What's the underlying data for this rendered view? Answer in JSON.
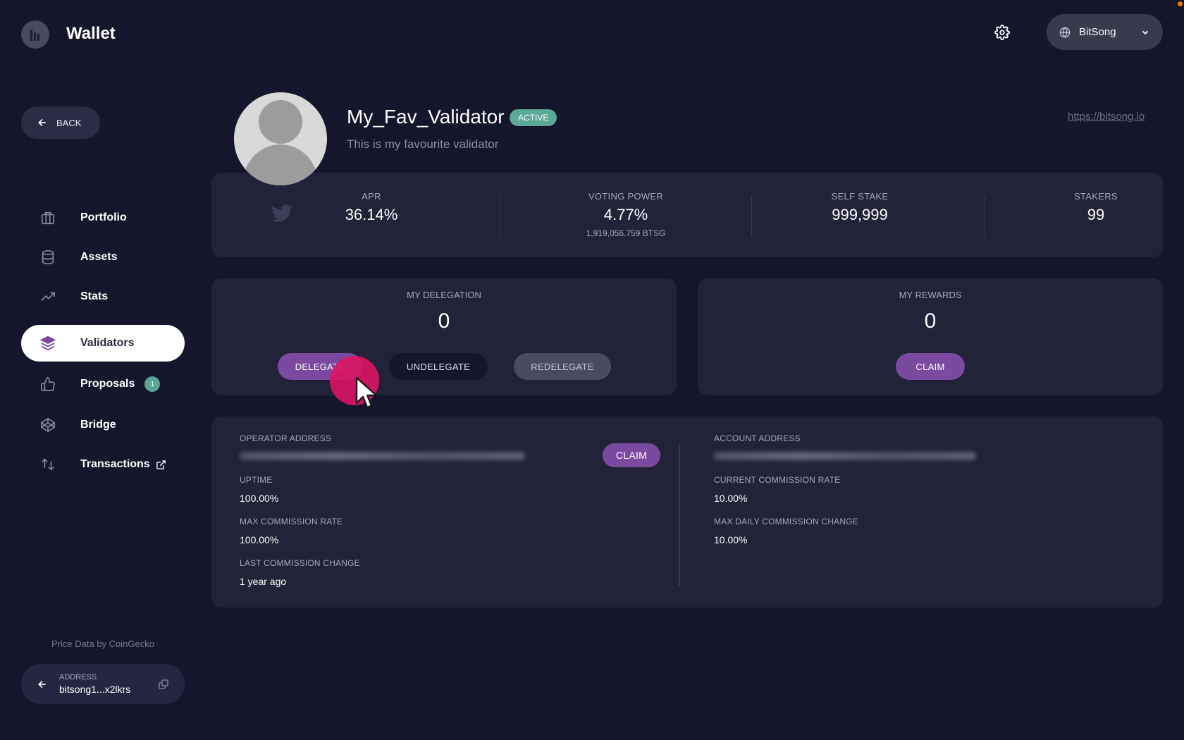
{
  "header": {
    "app_title": "Wallet",
    "network": "BitSong"
  },
  "sidebar": {
    "back_label": "BACK",
    "items": [
      {
        "label": "Portfolio",
        "icon": "briefcase-icon"
      },
      {
        "label": "Assets",
        "icon": "database-icon"
      },
      {
        "label": "Stats",
        "icon": "trending-up-icon"
      },
      {
        "label": "Validators",
        "icon": "layers-icon",
        "active": true
      },
      {
        "label": "Proposals",
        "icon": "thumbs-up-icon",
        "badge": "1"
      },
      {
        "label": "Bridge",
        "icon": "bridge-icon"
      },
      {
        "label": "Transactions",
        "icon": "swap-icon",
        "external": true
      }
    ],
    "price_data": "Price Data by CoinGecko",
    "address_label": "ADDRESS",
    "address_value": "bitsong1...x2lkrs"
  },
  "validator": {
    "name": "My_Fav_Validator",
    "status": "ACTIVE",
    "description": "This is my favourite validator",
    "website": "https://bitsong.io"
  },
  "stats": {
    "apr_label": "APR",
    "apr": "36.14%",
    "voting_power_label": "VOTING POWER",
    "voting_power": "4.77%",
    "voting_power_sub": "1,919,056.759 BTSG",
    "self_stake_label": "SELF STAKE",
    "self_stake": "999,999",
    "stakers_label": "STAKERS",
    "stakers": "99"
  },
  "delegation": {
    "title": "MY DELEGATION",
    "value": "0",
    "delegate": "DELEGATE",
    "undelegate": "UNDELEGATE",
    "redelegate": "REDELEGATE"
  },
  "rewards": {
    "title": "MY REWARDS",
    "value": "0",
    "claim": "CLAIM"
  },
  "details": {
    "operator_address_label": "OPERATOR ADDRESS",
    "claim": "CLAIM",
    "uptime_label": "UPTIME",
    "uptime": "100.00%",
    "max_commission_rate_label": "MAX COMMISSION RATE",
    "max_commission_rate": "100.00%",
    "last_commission_change_label": "LAST COMMISSION CHANGE",
    "last_commission_change": "1 year ago",
    "account_address_label": "ACCOUNT ADDRESS",
    "current_commission_rate_label": "CURRENT COMMISSION RATE",
    "current_commission_rate": "10.00%",
    "max_daily_commission_change_label": "MAX DAILY COMMISSION CHANGE",
    "max_daily_commission_change": "10.00%"
  },
  "colors": {
    "background": "#15152b",
    "card": "#222238",
    "accent_purple": "#7a4aa0",
    "active_green": "#5aa898",
    "click_highlight": "#dc1464"
  }
}
